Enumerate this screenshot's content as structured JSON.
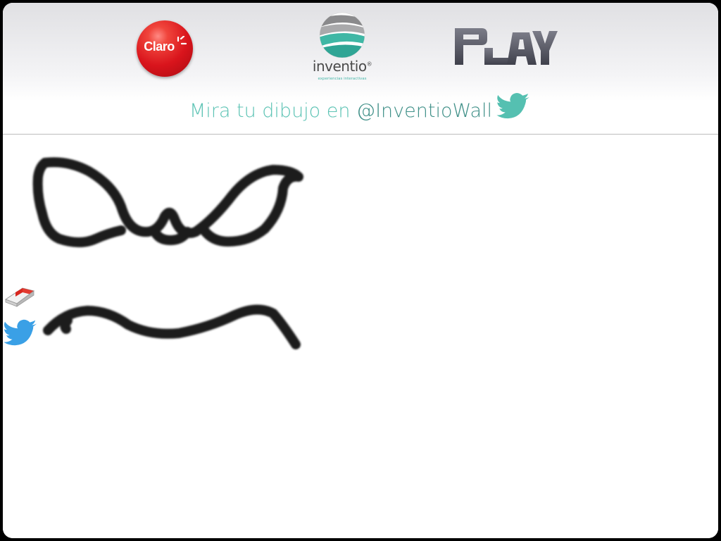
{
  "header": {
    "brand_left": "Claro",
    "brand_center": "inventio",
    "brand_center_tagline": "experiencias interactivas",
    "brand_right": "PLAY",
    "caption_prefix": "Mira tu dibujo en ",
    "caption_handle": "@InventioWall"
  },
  "tools": [
    {
      "name": "eraser",
      "icon": "eraser-icon"
    },
    {
      "name": "tweet",
      "icon": "twitter-bird-icon"
    }
  ],
  "colors": {
    "teal": "#5cc3b4",
    "teal_dark": "#3e8f87",
    "claro_red": "#d9141c",
    "ink": "#1a1a1a",
    "play_gray": "#5b5c68"
  }
}
